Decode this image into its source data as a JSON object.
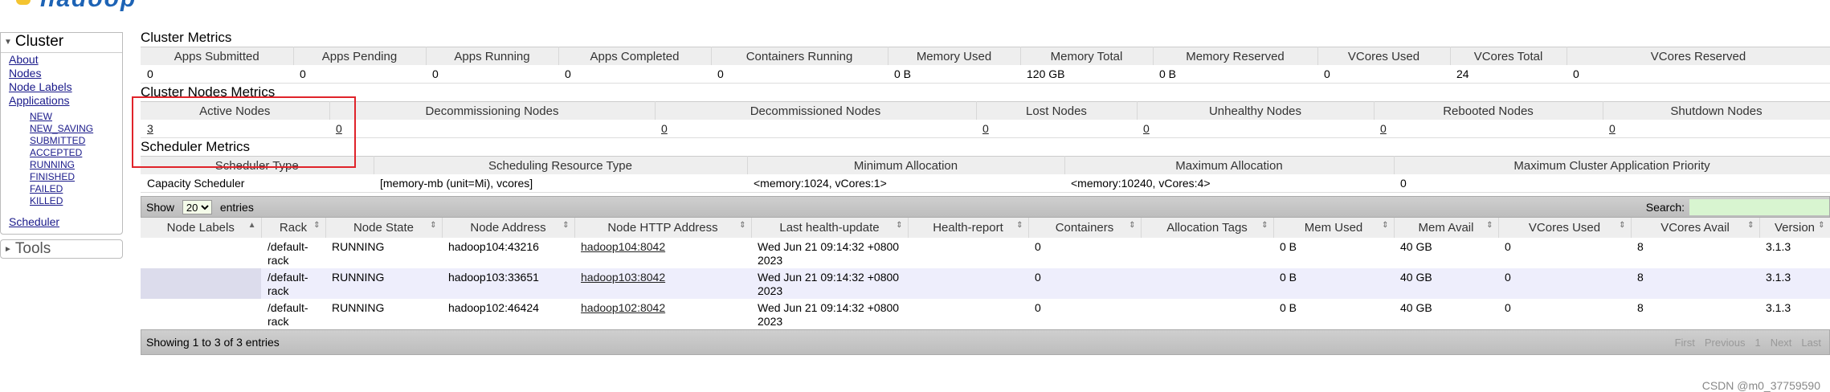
{
  "logo": {
    "text": "hadoop"
  },
  "nav": {
    "cluster_label": "Cluster",
    "links": [
      "About",
      "Nodes",
      "Node Labels",
      "Applications"
    ],
    "app_links": [
      "NEW",
      "NEW_SAVING",
      "SUBMITTED",
      "ACCEPTED",
      "RUNNING",
      "FINISHED",
      "FAILED",
      "KILLED"
    ],
    "scheduler": "Scheduler",
    "tools_label": "Tools"
  },
  "cluster_metrics": {
    "title": "Cluster Metrics",
    "headers": [
      "Apps Submitted",
      "Apps Pending",
      "Apps Running",
      "Apps Completed",
      "Containers Running",
      "Memory Used",
      "Memory Total",
      "Memory Reserved",
      "VCores Used",
      "VCores Total",
      "VCores Reserved"
    ],
    "values": [
      "0",
      "0",
      "0",
      "0",
      "0",
      "0 B",
      "120 GB",
      "0 B",
      "0",
      "24",
      "0"
    ]
  },
  "node_metrics": {
    "title": "Cluster Nodes Metrics",
    "headers": [
      "Active Nodes",
      "Decommissioning Nodes",
      "Decommissioned Nodes",
      "Lost Nodes",
      "Unhealthy Nodes",
      "Rebooted Nodes",
      "Shutdown Nodes"
    ],
    "values": [
      "3",
      "0",
      "0",
      "0",
      "0",
      "0",
      "0"
    ]
  },
  "scheduler_metrics": {
    "title": "Scheduler Metrics",
    "headers": [
      "Scheduler Type",
      "Scheduling Resource Type",
      "Minimum Allocation",
      "Maximum Allocation",
      "Maximum Cluster Application Priority"
    ],
    "values": [
      "Capacity Scheduler",
      "[memory-mb (unit=Mi), vcores]",
      "<memory:1024, vCores:1>",
      "<memory:10240, vCores:4>",
      "0"
    ]
  },
  "nodes_table": {
    "show_label": "Show",
    "page_size": "20",
    "entries_label": "entries",
    "search_label": "Search:",
    "columns": [
      "Node Labels",
      "Rack",
      "Node State",
      "Node Address",
      "Node HTTP Address",
      "Last health-update",
      "Health-report",
      "Containers",
      "Allocation Tags",
      "Mem Used",
      "Mem Avail",
      "VCores Used",
      "VCores Avail",
      "Version"
    ],
    "rows": [
      {
        "label": "",
        "rack": "/default-rack",
        "state": "RUNNING",
        "address": "hadoop104:43216",
        "http": "hadoop104:8042",
        "health_update": "Wed Jun 21 09:14:32 +0800 2023",
        "report": "",
        "containers": "0",
        "tags": "",
        "mem_used": "0 B",
        "mem_avail": "40 GB",
        "vc_used": "0",
        "vc_avail": "8",
        "version": "3.1.3"
      },
      {
        "label": "",
        "rack": "/default-rack",
        "state": "RUNNING",
        "address": "hadoop103:33651",
        "http": "hadoop103:8042",
        "health_update": "Wed Jun 21 09:14:32 +0800 2023",
        "report": "",
        "containers": "0",
        "tags": "",
        "mem_used": "0 B",
        "mem_avail": "40 GB",
        "vc_used": "0",
        "vc_avail": "8",
        "version": "3.1.3"
      },
      {
        "label": "",
        "rack": "/default-rack",
        "state": "RUNNING",
        "address": "hadoop102:46424",
        "http": "hadoop102:8042",
        "health_update": "Wed Jun 21 09:14:32 +0800 2023",
        "report": "",
        "containers": "0",
        "tags": "",
        "mem_used": "0 B",
        "mem_avail": "40 GB",
        "vc_used": "0",
        "vc_avail": "8",
        "version": "3.1.3"
      }
    ],
    "footer": "Showing 1 to 3 of 3 entries",
    "pager": [
      "First",
      "Previous",
      "1",
      "Next",
      "Last"
    ]
  },
  "watermark": "CSDN @m0_37759590",
  "colors": {
    "highlight": "#e0232a",
    "link": "#1a1a8a",
    "search_bg": "#d8f5d0"
  }
}
